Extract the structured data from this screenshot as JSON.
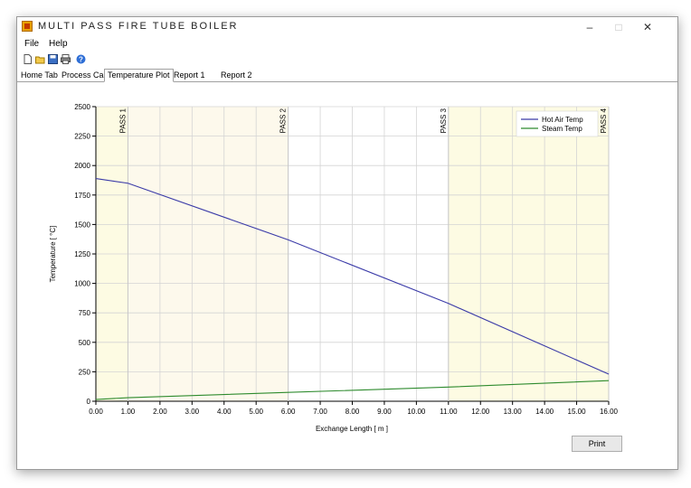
{
  "window": {
    "title": "MULTI PASS FIRE TUBE BOILER",
    "minimize": "–",
    "maximize": "□",
    "close": "✕"
  },
  "menu": {
    "file": "File",
    "help": "Help"
  },
  "toolbar": {
    "icons": [
      "new-icon",
      "open-icon",
      "save-icon",
      "print-icon",
      "help-icon"
    ]
  },
  "tabs": [
    {
      "label": "Home Tab"
    },
    {
      "label": "Process Calc"
    },
    {
      "label": "Temperature Plot"
    },
    {
      "label": "Report 1"
    },
    {
      "label": "Report 2"
    }
  ],
  "print_label": "Print",
  "chart_data": {
    "type": "line",
    "xlabel": "Exchange Length [ m ]",
    "ylabel": "Temperature [ °C]",
    "xlim": [
      0,
      16
    ],
    "ylim": [
      0,
      2500
    ],
    "x_ticks": [
      "0.00",
      "1.00",
      "2.00",
      "3.00",
      "4.00",
      "5.00",
      "6.00",
      "7.00",
      "8.00",
      "9.00",
      "10.00",
      "11.00",
      "12.00",
      "13.00",
      "14.00",
      "15.00",
      "16.00"
    ],
    "y_ticks": [
      "0",
      "250",
      "500",
      "750",
      "1000",
      "1250",
      "1500",
      "1750",
      "2000",
      "2250",
      "2500"
    ],
    "grid": true,
    "legend_position": "top-right",
    "pass_regions": [
      {
        "label": "PASS 1",
        "x_start": 0,
        "x_end": 1,
        "color": "#fdfbe3"
      },
      {
        "label": "PASS 2",
        "x_start": 1,
        "x_end": 6,
        "color": "#fdf9ec"
      },
      {
        "label": "PASS 3",
        "x_start": 6,
        "x_end": 11,
        "color": "#ffffff"
      },
      {
        "label": "PASS 4",
        "x_start": 11,
        "x_end": 16,
        "color": "#fdfbe3"
      }
    ],
    "series": [
      {
        "name": "Hot Air Temp",
        "color": "#3b3ba8",
        "x": [
          0,
          1,
          6,
          11,
          16
        ],
        "y": [
          1890,
          1850,
          1370,
          830,
          230
        ]
      },
      {
        "name": "Steam Temp",
        "color": "#2e8b2e",
        "x": [
          0,
          1,
          6,
          11,
          16
        ],
        "y": [
          15,
          30,
          75,
          120,
          175
        ]
      }
    ]
  }
}
